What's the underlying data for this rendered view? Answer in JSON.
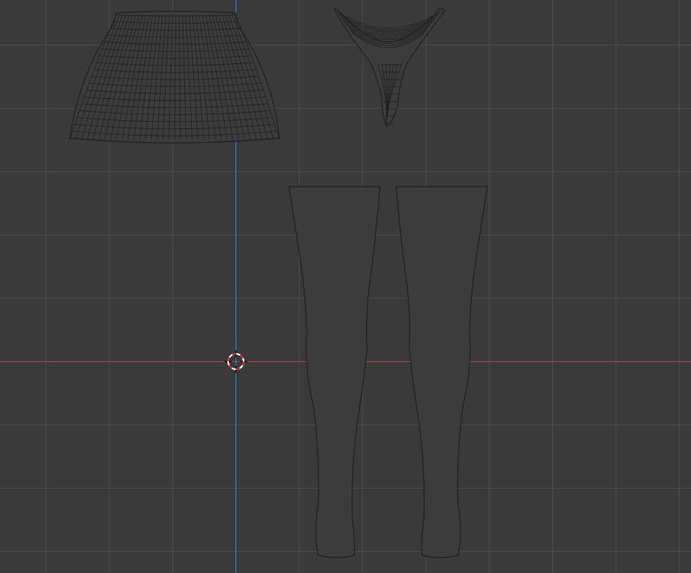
{
  "viewport": {
    "view": "orthographic-front",
    "background_color": "#3a3a3a",
    "grid_color": "#4a4a4a",
    "x_axis_color": "#b0454d",
    "y_axis_color": "#4a78b0",
    "wireframe_color": "#1f1f1f"
  },
  "scene": {
    "cursor": "3d-cursor-icon",
    "objects": [
      {
        "name": "skirt",
        "icon": "mesh-icon"
      },
      {
        "name": "thong",
        "icon": "mesh-icon"
      },
      {
        "name": "left-stocking",
        "icon": "mesh-icon"
      },
      {
        "name": "right-stocking",
        "icon": "mesh-icon"
      }
    ]
  }
}
